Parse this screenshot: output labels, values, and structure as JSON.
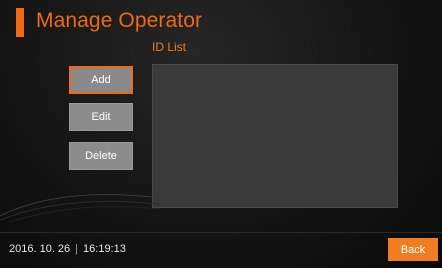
{
  "header": {
    "title": "Manage Operator"
  },
  "id_list": {
    "label": "ID List",
    "items": []
  },
  "actions": {
    "add_label": "Add",
    "edit_label": "Edit",
    "delete_label": "Delete"
  },
  "footer": {
    "date": "2016. 10. 26",
    "separator": "|",
    "time": "16:19:13",
    "back_label": "Back"
  },
  "colors": {
    "accent": "#ee6a14",
    "button_gray": "#8c8c8c",
    "list_background": "#3a3a3a"
  }
}
